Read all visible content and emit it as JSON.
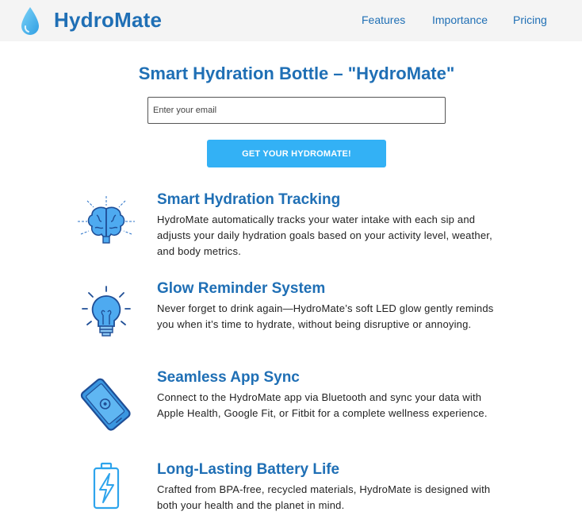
{
  "brand": {
    "name": "HydroMate",
    "logo_icon": "water-drop-icon",
    "primary_color": "#1f6fb5",
    "accent_color": "#33b1f5"
  },
  "nav": {
    "links": [
      {
        "label": "Features"
      },
      {
        "label": "Importance"
      },
      {
        "label": "Pricing"
      }
    ]
  },
  "hero": {
    "title": "Smart Hydration Bottle – \"HydroMate\"",
    "email_placeholder": "Enter your email",
    "email_value": "",
    "cta_label": "GET YOUR HYDROMATE!"
  },
  "features": [
    {
      "icon": "brain-icon",
      "title": "Smart Hydration Tracking",
      "description": "HydroMate automatically tracks your water intake with each sip and adjusts your daily hydration goals based on your activity level, weather, and body metrics."
    },
    {
      "icon": "lightbulb-icon",
      "title": "Glow Reminder System",
      "description": "Never forget to drink again—HydroMate’s soft LED glow gently reminds you when it’s time to hydrate, without being disruptive or annoying."
    },
    {
      "icon": "smartphone-icon",
      "title": "Seamless App Sync",
      "description": "Connect to the HydroMate app via Bluetooth and sync your data with Apple Health, Google Fit, or Fitbit for a complete wellness experience."
    },
    {
      "icon": "battery-charging-icon",
      "title": "Long-Lasting Battery Life",
      "description": "Crafted from BPA-free, recycled materials, HydroMate is designed with both your health and the planet in mind."
    }
  ]
}
